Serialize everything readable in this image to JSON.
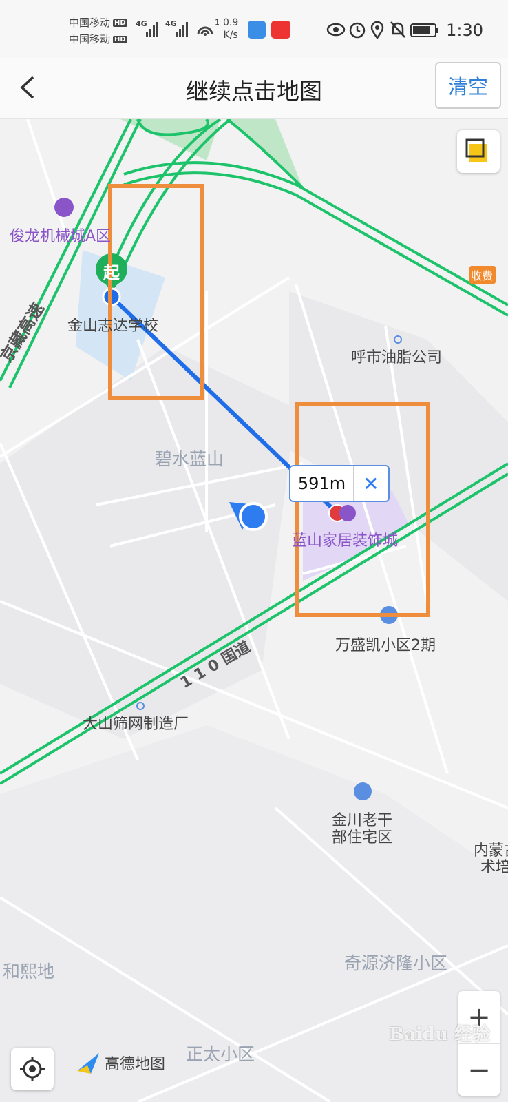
{
  "status": {
    "carrier1": "中国移动",
    "carrier2": "中国移动",
    "hd": "HD",
    "net1": "4G",
    "net2": "4G",
    "hotspot_count": "1",
    "speed_value": "0.9",
    "speed_unit": "K/s",
    "time": "1:30",
    "icons": [
      "eye-icon",
      "alarm-icon",
      "location-icon",
      "mute-icon",
      "battery-icon"
    ]
  },
  "header": {
    "title": "继续点击地图",
    "clear_label": "清空"
  },
  "map": {
    "labels": {
      "junlong": "俊龙机械城A区",
      "jinshan_school": "金山志达学校",
      "jingzang": "京藏高速",
      "hushi_oil": "呼市油脂公司",
      "bishui": "碧水蓝山",
      "lanshan_mall": "蓝山家居装饰城",
      "wanshengkai": "万盛凯小区2期",
      "guodao": "1 1 0 国道",
      "dashan": "大山筛网制造厂",
      "jinchuan_1": "金川老干",
      "jinchuan_2": "部住宅区",
      "neimeng_1": "内蒙古",
      "neimeng_2": "术培",
      "heheidi": "和熙地",
      "qiyuan": "奇源济隆小区",
      "zhengtai": "正太小区",
      "toll": "收费",
      "start": "起"
    },
    "distance": {
      "value": "591m",
      "close": "✕"
    },
    "brand": "高德地图",
    "watermark": "Baidu 经验",
    "zoom_in": "+",
    "zoom_out": "−",
    "colors": {
      "route": "#1f6de8",
      "highway": "#1cc36a",
      "highlight": "#ee8e3c",
      "poi": "#8a55c8"
    }
  }
}
